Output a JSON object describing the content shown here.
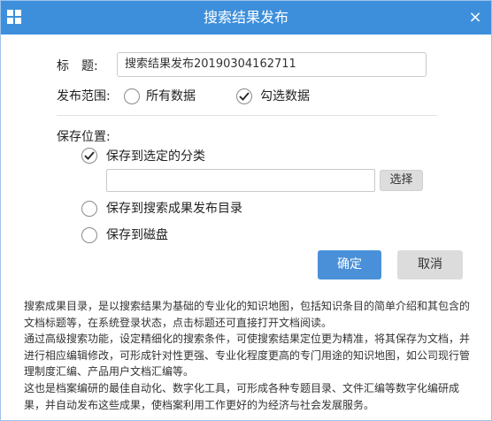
{
  "dialog": {
    "title": "搜索结果发布",
    "close_glyph": "×",
    "app_icon": "grid-icon",
    "close_icon": "close-icon"
  },
  "form": {
    "title_label": "标　题:",
    "title_value": "搜索结果发布20190304162711",
    "scope_label": "发布范围:",
    "scope_options": [
      {
        "label": "所有数据",
        "selected": false
      },
      {
        "label": "勾选数据",
        "selected": true
      }
    ],
    "location_label": "保存位置:",
    "location_options": [
      {
        "label": "保存到选定的分类",
        "selected": true
      },
      {
        "label": "保存到搜索成果发布目录",
        "selected": false
      },
      {
        "label": "保存到磁盘",
        "selected": false
      }
    ],
    "category_path_value": "",
    "choose_button": "选择"
  },
  "buttons": {
    "ok": "确定",
    "cancel": "取消"
  },
  "description": [
    "搜索成果目录，是以搜索结果为基础的专业化的知识地图，包括知识条目的简单介绍和其包含的文档标题等，在系统登录状态，点击标题还可直接打开文档阅读。",
    "通过高级搜索功能，设定精细化的搜索条件，可使搜索结果定位更为精准，将其保存为文档，并进行相应编辑修改，可形成针对性更强、专业化程度更高的专门用途的知识地图，如公司现行管理制度汇编、产品用户文档汇编等。",
    "这也是档案编研的最佳自动化、数字化工具，可形成各种专题目录、文件汇编等数字化编研成果，并自动发布这些成果，使档案利用工作更好的为经济与社会发展服务。"
  ],
  "colors": {
    "titlebar": "#3d8fdc",
    "primary_button": "#4a90d9",
    "secondary_button": "#dcdcdc"
  }
}
